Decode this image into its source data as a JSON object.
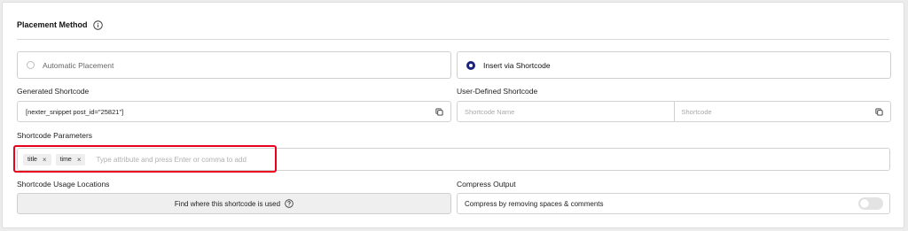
{
  "header": {
    "title": "Placement Method",
    "info_icon": "info-icon"
  },
  "placement": {
    "options": [
      {
        "label": "Automatic Placement",
        "selected": false
      },
      {
        "label": "Insert via Shortcode",
        "selected": true
      }
    ]
  },
  "generated": {
    "label": "Generated Shortcode",
    "value": "[nexter_snippet post_id=\"25821\"]",
    "copy_icon": "copy-icon"
  },
  "user_defined": {
    "label": "User-Defined Shortcode",
    "name_placeholder": "Shortcode Name",
    "shortcode_placeholder": "Shortcode",
    "copy_icon": "copy-icon"
  },
  "parameters": {
    "label": "Shortcode Parameters",
    "tags": [
      {
        "label": "title",
        "remove": "×"
      },
      {
        "label": "time",
        "remove": "×"
      }
    ],
    "placeholder": "Type attribute and press Enter or comma to add"
  },
  "usage": {
    "label": "Shortcode Usage Locations",
    "button_label": "Find where this shortcode is used",
    "help_icon": "help-icon"
  },
  "compress": {
    "label": "Compress Output",
    "option_text": "Compress by removing spaces & comments",
    "enabled": false
  },
  "colors": {
    "accent": "#1a237e",
    "highlight": "#e8001c"
  }
}
